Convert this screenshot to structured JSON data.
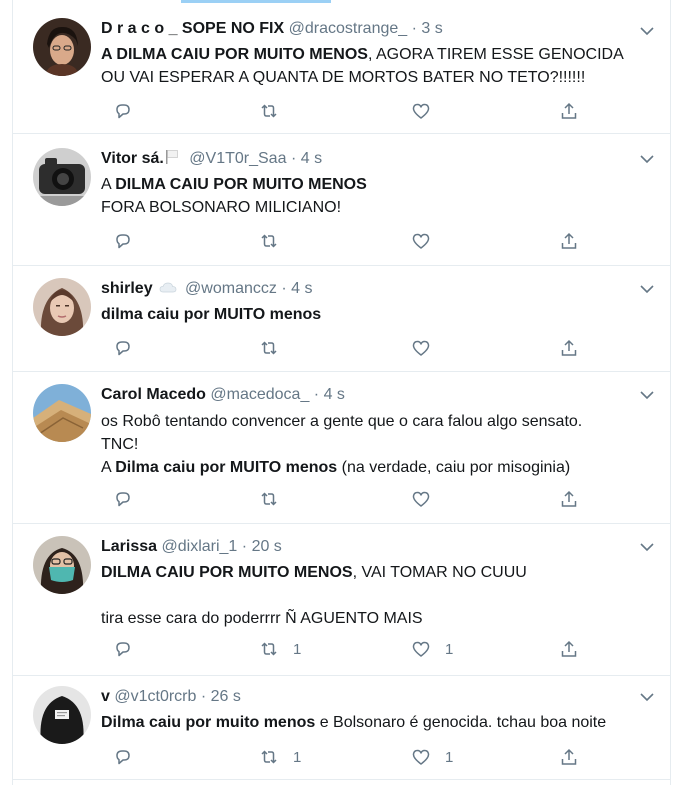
{
  "tweets": [
    {
      "name": "D r a c o _ SOPE NO FIX",
      "handle": "@dracostrange_",
      "separator": "·",
      "time": "3 s",
      "lines": [
        {
          "bold": "A DILMA CAIU POR MUITO MENOS",
          "normal": ", AGORA TIREM ESSE GENOCIDA"
        },
        {
          "bold": "",
          "normal": "OU VAI ESPERAR A QUANTA DE MORTOS BATER NO TETO?!!!!!!"
        }
      ],
      "retweets": "",
      "likes": ""
    },
    {
      "name": "Vitor sá.",
      "handle": "@V1T0r_Saa",
      "separator": "·",
      "time": "4 s",
      "lines": [
        {
          "bold": "DILMA CAIU POR MUITO MENOS",
          "prefix": "A ",
          "normal": ""
        },
        {
          "bold": "",
          "normal": "FORA BOLSONARO MILICIANO!"
        }
      ],
      "retweets": "",
      "likes": ""
    },
    {
      "name": "shirley",
      "handle": "@womanccz",
      "separator": "·",
      "time": "4 s",
      "lines": [
        {
          "bold": "dilma caiu por MUITO menos",
          "normal": ""
        }
      ],
      "retweets": "",
      "likes": ""
    },
    {
      "name": "Carol Macedo",
      "handle": "@macedoca_",
      "separator": "·",
      "time": "4 s",
      "lines": [
        {
          "bold": "",
          "normal": "os Robô tentando convencer a gente que o cara falou algo sensato."
        },
        {
          "bold": "",
          "normal": "TNC!"
        },
        {
          "prefix": "A ",
          "bold": "Dilma caiu por MUITO menos",
          "normal": " (na verdade, caiu por misoginia)"
        }
      ],
      "retweets": "",
      "likes": ""
    },
    {
      "name": "Larissa",
      "handle": "@dixlari_1",
      "separator": "·",
      "time": "20 s",
      "lines": [
        {
          "bold": "DILMA CAIU POR MUITO MENOS",
          "normal": ", VAI TOMAR NO CUUU"
        },
        {
          "blank": true
        },
        {
          "bold": "",
          "normal": "tira esse cara do poderrrr Ñ AGUENTO MAIS"
        }
      ],
      "retweets": "1",
      "likes": "1"
    },
    {
      "name": "v",
      "handle": "@v1ct0rcrb",
      "separator": "·",
      "time": "26 s",
      "lines": [
        {
          "bold": "Dilma caiu por muito menos",
          "normal": " e Bolsonaro é genocida. tchau boa noite"
        }
      ],
      "retweets": "1",
      "likes": "1"
    }
  ],
  "icons": {
    "reply": "reply-icon",
    "retweet": "retweet-icon",
    "like": "heart-icon",
    "share": "share-icon",
    "caret": "chevron-down-icon"
  },
  "colors": {
    "icon_gray": "#657786",
    "text": "#14171a",
    "divider": "#e6ecf0"
  }
}
